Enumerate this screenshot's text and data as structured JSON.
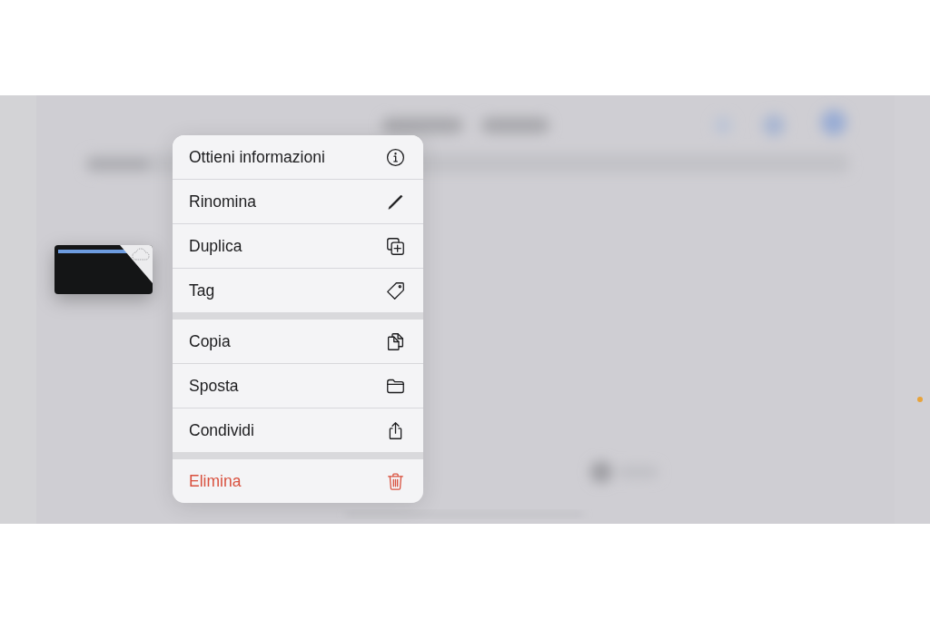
{
  "context_menu": {
    "groups": [
      {
        "items": [
          {
            "label": "Ottieni informazioni",
            "destructive": false
          },
          {
            "label": "Rinomina",
            "destructive": false
          },
          {
            "label": "Duplica",
            "destructive": false
          },
          {
            "label": "Tag",
            "destructive": false
          }
        ]
      },
      {
        "items": [
          {
            "label": "Copia",
            "destructive": false
          },
          {
            "label": "Sposta",
            "destructive": false
          },
          {
            "label": "Condividi",
            "destructive": false
          }
        ]
      },
      {
        "items": [
          {
            "label": "Elimina",
            "destructive": true
          }
        ]
      }
    ]
  }
}
